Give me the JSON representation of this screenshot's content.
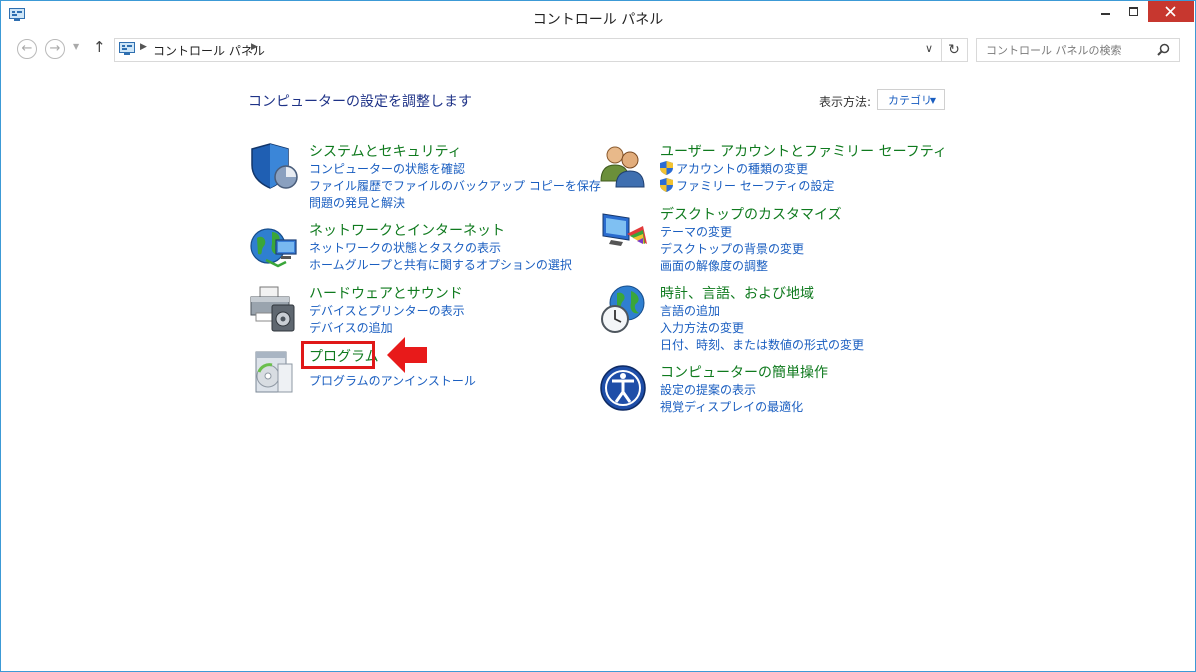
{
  "window": {
    "title": "コントロール パネル"
  },
  "address": {
    "path": "コントロール パネル",
    "search_placeholder": "コントロール パネルの検索"
  },
  "content": {
    "heading": "コンピューターの設定を調整します",
    "view_label": "表示方法:",
    "view_value": "カテゴリ"
  },
  "categories": [
    {
      "title": "システムとセキュリティ",
      "icon": "shield-icon",
      "links": [
        "コンピューターの状態を確認",
        "ファイル履歴でファイルのバックアップ コピーを保存",
        "問題の発見と解決"
      ]
    },
    {
      "title": "ネットワークとインターネット",
      "icon": "network-icon",
      "links": [
        "ネットワークの状態とタスクの表示",
        "ホームグループと共有に関するオプションの選択"
      ]
    },
    {
      "title": "ハードウェアとサウンド",
      "icon": "printer-icon",
      "links": [
        "デバイスとプリンターの表示",
        "デバイスの追加"
      ]
    },
    {
      "title": "プログラム",
      "icon": "programs-icon",
      "links": [
        "プログラムのアンインストール"
      ]
    },
    {
      "title": "ユーザー アカウントとファミリー セーフティ",
      "icon": "users-icon",
      "links": [
        "アカウントの種類の変更",
        "ファミリー セーフティの設定"
      ]
    },
    {
      "title": "デスクトップのカスタマイズ",
      "icon": "desktop-icon",
      "links": [
        "テーマの変更",
        "デスクトップの背景の変更",
        "画面の解像度の調整"
      ]
    },
    {
      "title": "時計、言語、および地域",
      "icon": "globe-clock-icon",
      "links": [
        "言語の追加",
        "入力方法の変更",
        "日付、時刻、または数値の形式の変更"
      ]
    },
    {
      "title": "コンピューターの簡単操作",
      "icon": "ease-of-access-icon",
      "links": [
        "設定の提案の表示",
        "視覚ディスプレイの最適化"
      ]
    }
  ],
  "colors": {
    "category_title": "#0f7a1e",
    "link": "#1a5ec0",
    "heading": "#1e3287",
    "highlight": "#e01818",
    "close_button": "#c7372f"
  }
}
